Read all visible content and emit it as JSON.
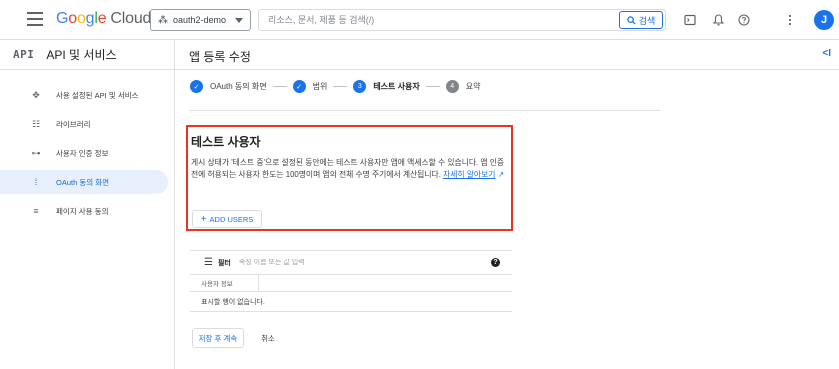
{
  "topbar": {
    "logo_g": "G",
    "logo_o1": "o",
    "logo_o2": "o",
    "logo_g2": "g",
    "logo_l": "l",
    "logo_e": "e",
    "logo_cloud": "Cloud",
    "project_name": "oauth2-demo",
    "search_placeholder": "리소스, 문서, 제품 등 검색(/)",
    "search_button": "검색",
    "avatar_initial": "J"
  },
  "sidebar": {
    "badge": "API",
    "title": "API 및 서비스",
    "items": [
      {
        "label": "사용 설정된 API 및 서비스",
        "icon": "api-icon"
      },
      {
        "label": "라이브러리",
        "icon": "library-icon"
      },
      {
        "label": "사용자 인증 정보",
        "icon": "key-icon"
      },
      {
        "label": "OAuth 동의 화면",
        "icon": "consent-icon",
        "active": true
      },
      {
        "label": "페이지 사용 동의",
        "icon": "settings-list-icon"
      }
    ]
  },
  "main": {
    "title": "앱 등록 수정",
    "steps": [
      {
        "label": "OAuth 동의 화면",
        "state": "done",
        "marker": ""
      },
      {
        "label": "범위",
        "state": "done",
        "marker": ""
      },
      {
        "label": "테스트 사용자",
        "state": "current",
        "marker": "3"
      },
      {
        "label": "요약",
        "state": "todo",
        "marker": "4"
      }
    ],
    "section": {
      "title": "테스트 사용자",
      "description": "게시 상태가 '테스트 중'으로 설정된 동안에는 테스트 사용자만 앱에 액세스할 수 있습니다. 앱 인증 전에 허용되는 사용자 한도는 100명이며 앱의 전체 수명 주기에서 계산됩니다.",
      "learn_more": "자세히 알아보기",
      "add_users": "ADD USERS"
    },
    "table": {
      "filter_label": "필터",
      "filter_placeholder": "속성 이름 또는 값 입력",
      "column_header": "사용자 정보",
      "empty_text": "표시할 행이 없습니다."
    },
    "actions": {
      "save": "저장 후 계속",
      "cancel": "취소"
    }
  }
}
